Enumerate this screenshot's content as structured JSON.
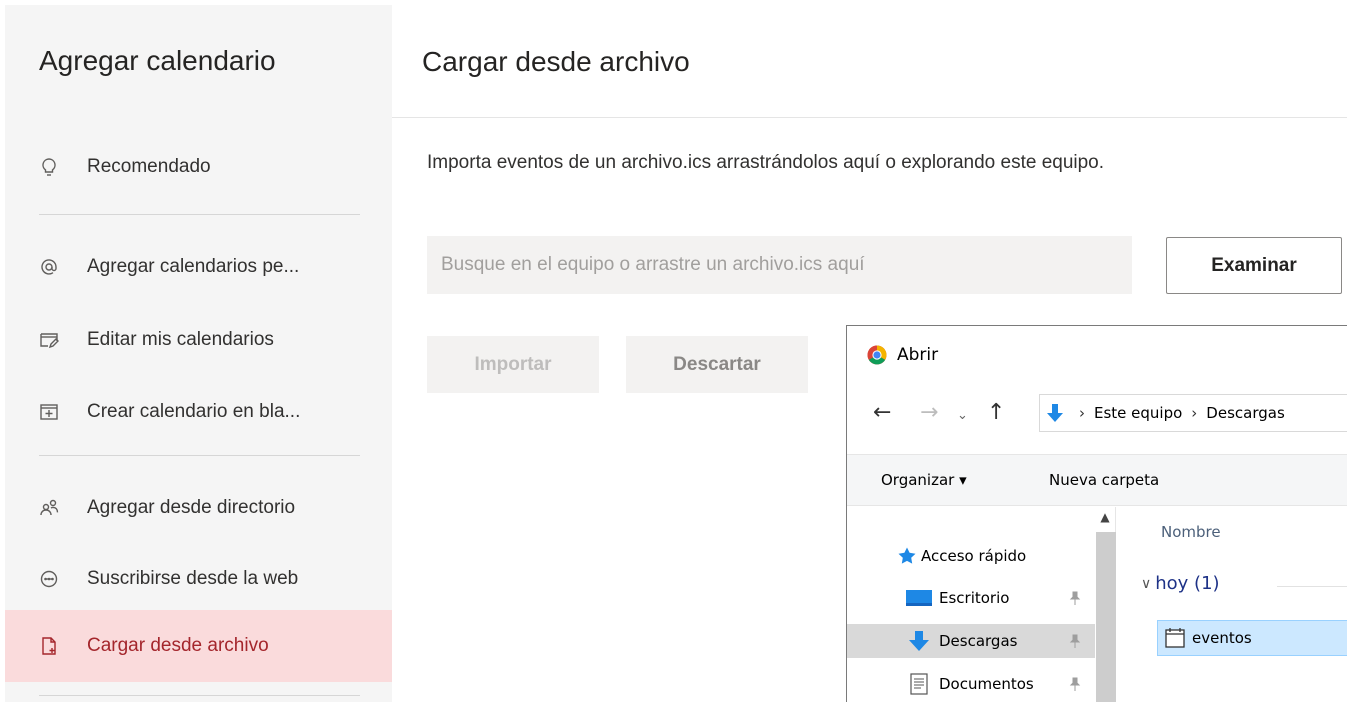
{
  "sidebar": {
    "title": "Agregar calendario",
    "items": [
      {
        "label": "Recomendado",
        "icon": "lightbulb-icon"
      },
      {
        "label": "Agregar calendarios pe...",
        "icon": "at-icon"
      },
      {
        "label": "Editar mis calendarios",
        "icon": "edit-calendar-icon"
      },
      {
        "label": "Crear calendario en bla...",
        "icon": "add-calendar-icon"
      },
      {
        "label": "Agregar desde directorio",
        "icon": "people-icon"
      },
      {
        "label": "Suscribirse desde la web",
        "icon": "link-icon"
      },
      {
        "label": "Cargar desde archivo",
        "icon": "upload-file-icon"
      }
    ],
    "active_color": "#a4262c",
    "active_bg": "#fadbdc"
  },
  "main": {
    "title": "Cargar desde archivo",
    "description": "Importa eventos de un archivo.ics arrastrándolos aquí o explorando este equipo.",
    "file_input_placeholder": "Busque en el equipo o arrastre un archivo.ics aquí",
    "browse_label": "Examinar",
    "import_label": "Importar",
    "discard_label": "Descartar"
  },
  "dialog": {
    "title": "Abrir",
    "breadcrumb": [
      "Este equipo",
      "Descargas"
    ],
    "toolbar": {
      "organize_label": "Organizar ▾",
      "new_folder_label": "Nueva carpeta"
    },
    "nav_tree": [
      {
        "label": "Acceso rápido",
        "icon": "star-icon"
      },
      {
        "label": "Escritorio",
        "icon": "desktop-folder-icon"
      },
      {
        "label": "Descargas",
        "icon": "download-folder-icon"
      },
      {
        "label": "Documentos",
        "icon": "documents-folder-icon"
      }
    ],
    "column_name": "Nombre",
    "group_label": "hoy (1)",
    "file_name": "eventos"
  }
}
